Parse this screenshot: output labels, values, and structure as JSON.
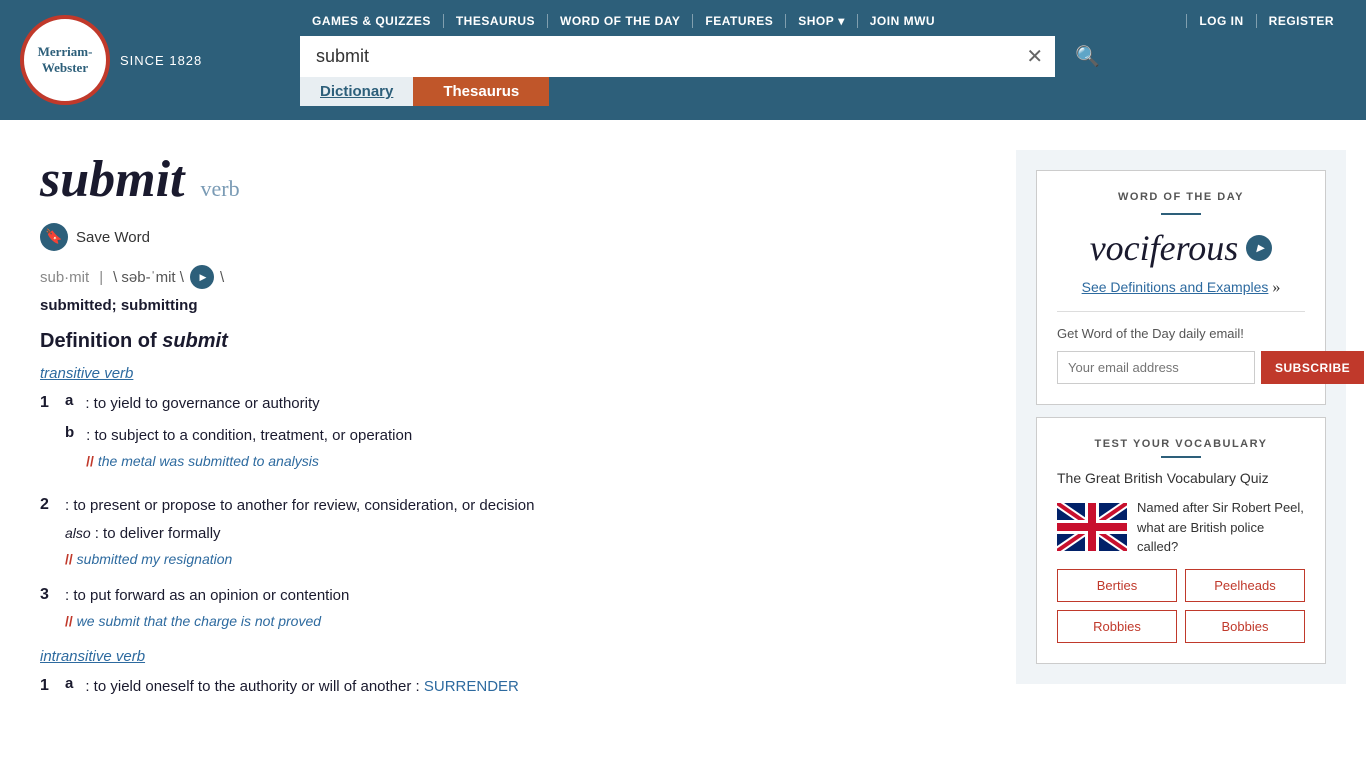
{
  "header": {
    "logo_line1": "Merriam-",
    "logo_line2": "Webster",
    "since": "SINCE 1828",
    "nav": {
      "games": "GAMES & QUIZZES",
      "thesaurus": "THESAURUS",
      "word_of_day": "WORD OF THE DAY",
      "features": "FEATURES",
      "shop": "SHOP",
      "join": "JOIN MWU",
      "login": "LOG IN",
      "register": "REGISTER"
    },
    "search_value": "submit",
    "search_placeholder": "Search",
    "tab_dictionary": "Dictionary",
    "tab_thesaurus": "Thesaurus"
  },
  "entry": {
    "word": "submit",
    "pos": "verb",
    "save_label": "Save Word",
    "pron_word": "sub·mit",
    "pron_sep": "|",
    "pron_ipa": "\\ səb-ˈmit \\",
    "forms": "submitted; submitting",
    "def_header": "Definition of submit",
    "verb_type_transitive": "transitive verb",
    "verb_type_intransitive": "intransitive verb",
    "definitions": [
      {
        "num": "1",
        "subs": [
          {
            "letter": "a",
            "text": ": to yield to governance or authority",
            "example": ""
          },
          {
            "letter": "b",
            "text": ": to subject to a condition, treatment, or operation",
            "example": "// the metal was submitted to analysis"
          }
        ]
      },
      {
        "num": "2",
        "subs": [
          {
            "letter": "",
            "text": ": to present or propose to another for review, consideration, or decision",
            "example": ""
          }
        ],
        "also": "also : to deliver formally",
        "also_example": "// submitted my resignation"
      },
      {
        "num": "3",
        "subs": [
          {
            "letter": "",
            "text": ": to put forward as an opinion or contention",
            "example": "// we submit that the charge is not proved"
          }
        ]
      }
    ],
    "intrans_definitions": [
      {
        "num": "1",
        "subs": [
          {
            "letter": "a",
            "text": ": to yield oneself to the authority or will of another :",
            "link": "SURRENDER"
          }
        ]
      }
    ]
  },
  "wotd": {
    "label": "WORD OF THE DAY",
    "word": "vociferous",
    "link_text": "See Definitions and Examples",
    "link_arrow": "»",
    "email_label": "Get Word of the Day daily email!",
    "email_placeholder": "Your email address",
    "subscribe_btn": "SUBSCRIBE"
  },
  "vocab": {
    "label": "TEST YOUR VOCABULARY",
    "quiz_title": "The Great British Vocabulary Quiz",
    "question": "Named after Sir Robert Peel, what are British police called?",
    "options": [
      "Berties",
      "Peelheads",
      "Robbies",
      "Bobbies"
    ]
  }
}
